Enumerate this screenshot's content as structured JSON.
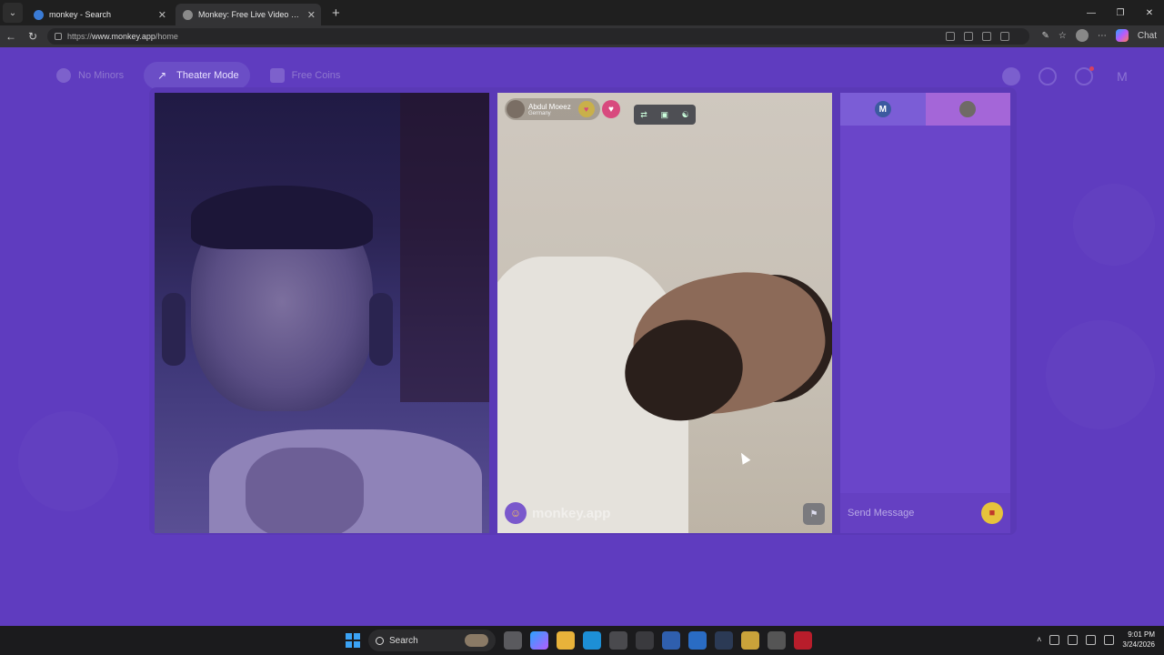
{
  "browser": {
    "tabs": [
      {
        "title": "monkey - Search",
        "active": false
      },
      {
        "title": "Monkey: Free Live Video Chat",
        "active": true
      }
    ],
    "url_prefix": "https://",
    "url_domain": "www.monkey.app",
    "url_path": "/home",
    "copilot_label": "Chat"
  },
  "topnav": {
    "no_minors": "No Minors",
    "theater_mode": "Theater Mode",
    "free_coins": "Free Coins",
    "profile_initial": "M"
  },
  "video": {
    "partner_name": "Abdul Moeez",
    "partner_country": "Germany",
    "watermark": "monkey.app"
  },
  "chat": {
    "self_initial": "M",
    "input_placeholder": "Send Message"
  },
  "taskbar": {
    "search_label": "Search",
    "time": "9:01 PM",
    "date": "3/24/2026"
  }
}
